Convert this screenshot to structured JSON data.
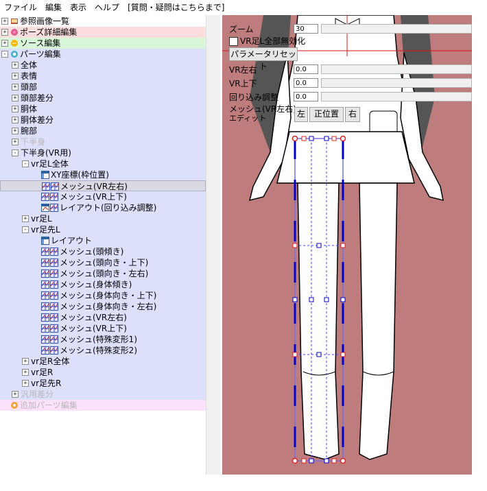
{
  "menu": [
    "ファイル",
    "編集",
    "表示",
    "ヘルプ",
    "[質問・疑問はこちらまで]"
  ],
  "tree": [
    {
      "label": "参照画像一覧",
      "level": 0,
      "exp": "+",
      "icon": "book-icon",
      "bg": "none"
    },
    {
      "label": "ポーズ詳細編集",
      "level": 0,
      "exp": "+",
      "icon": "pose-icon",
      "bg": "red"
    },
    {
      "label": "ソース編集",
      "level": 0,
      "exp": "+",
      "icon": "source-icon",
      "bg": "green"
    },
    {
      "label": "パーツ編集",
      "level": 0,
      "exp": "-",
      "icon": "parts-icon",
      "bg": "blue"
    },
    {
      "label": "全体",
      "level": 1,
      "exp": "+",
      "bg": "blue"
    },
    {
      "label": "表情",
      "level": 1,
      "exp": "+",
      "bg": "blue"
    },
    {
      "label": "頭部",
      "level": 1,
      "exp": "+",
      "bg": "blue"
    },
    {
      "label": "頭部差分",
      "level": 1,
      "exp": "+",
      "bg": "blue"
    },
    {
      "label": "胴体",
      "level": 1,
      "exp": "+",
      "bg": "blue"
    },
    {
      "label": "胴体差分",
      "level": 1,
      "exp": "+",
      "bg": "blue"
    },
    {
      "label": "腕部",
      "level": 1,
      "exp": "+",
      "bg": "blue"
    },
    {
      "label": "下半身",
      "level": 1,
      "exp": "+",
      "bg": "blue",
      "gray": true
    },
    {
      "label": "下半身(VR用)",
      "level": 1,
      "exp": "-",
      "bg": "blue"
    },
    {
      "label": "vr足L全体",
      "level": 2,
      "exp": "-",
      "bg": "blue"
    },
    {
      "label": "XY座標(枠位置)",
      "level": 3,
      "icon": "layout-icon",
      "bg": "blue"
    },
    {
      "label": "メッシュ(VR左右)",
      "level": 3,
      "icon": "mesh-icon",
      "bg": "blue",
      "selected": true
    },
    {
      "label": "メッシュ(VR上下)",
      "level": 3,
      "icon": "mesh-icon",
      "bg": "blue"
    },
    {
      "label": "レイアウト(回り込み調整)",
      "level": 3,
      "icon": "layout-mesh-icon",
      "bg": "blue"
    },
    {
      "label": "vr足L",
      "level": 2,
      "exp": "+",
      "bg": "blue"
    },
    {
      "label": "vr足先L",
      "level": 2,
      "exp": "-",
      "bg": "blue"
    },
    {
      "label": "レイアウト",
      "level": 3,
      "icon": "layout-icon",
      "bg": "blue"
    },
    {
      "label": "メッシュ(頭傾き)",
      "level": 3,
      "icon": "mesh-icon",
      "bg": "blue"
    },
    {
      "label": "メッシュ(頭向き・上下)",
      "level": 3,
      "icon": "mesh-icon",
      "bg": "blue"
    },
    {
      "label": "メッシュ(頭向き・左右)",
      "level": 3,
      "icon": "mesh-icon",
      "bg": "blue"
    },
    {
      "label": "メッシュ(身体傾き)",
      "level": 3,
      "icon": "mesh-icon",
      "bg": "blue"
    },
    {
      "label": "メッシュ(身体向き・上下)",
      "level": 3,
      "icon": "mesh-icon",
      "bg": "blue"
    },
    {
      "label": "メッシュ(身体向き・左右)",
      "level": 3,
      "icon": "mesh-icon",
      "bg": "blue"
    },
    {
      "label": "メッシュ(VR左右)",
      "level": 3,
      "icon": "mesh-icon",
      "bg": "blue"
    },
    {
      "label": "メッシュ(VR上下)",
      "level": 3,
      "icon": "mesh-icon",
      "bg": "blue"
    },
    {
      "label": "メッシュ(特殊変形1)",
      "level": 3,
      "icon": "mesh-icon",
      "bg": "blue"
    },
    {
      "label": "メッシュ(特殊変形2)",
      "level": 3,
      "icon": "mesh-icon",
      "bg": "blue"
    },
    {
      "label": "vr足R全体",
      "level": 2,
      "exp": "+",
      "bg": "blue"
    },
    {
      "label": "vr足R",
      "level": 2,
      "exp": "+",
      "bg": "blue"
    },
    {
      "label": "vr足先R",
      "level": 2,
      "exp": "+",
      "bg": "blue"
    },
    {
      "label": "汎用差分",
      "level": 1,
      "exp": "+",
      "bg": "blue",
      "gray": true
    },
    {
      "label": "追加パーツ編集",
      "level": 0,
      "icon": "addparts-icon",
      "bg": "pink",
      "gray": true
    }
  ],
  "controls": {
    "zoom_label": "ズーム",
    "zoom_value": "30",
    "disable_label": "VR足L全部無効化",
    "reset_label": "パラメータリセット",
    "vr_lr_label": "VR左右",
    "vr_lr_value": "0.0",
    "vr_ud_label": "VR上下",
    "vr_ud_value": "0.0",
    "wrap_label": "回り込み調整",
    "wrap_value": "0.0",
    "mesh_label": "メッシュ(VR左右)",
    "edit_label": "エディット",
    "left_btn": "左",
    "center_btn": "正位置",
    "right_btn": "右"
  },
  "colors": {
    "canvas_bg": "#bf7c7c",
    "mesh_line": "#3030e0",
    "handle_red": "#e02020",
    "crosshair": "#e01010"
  }
}
